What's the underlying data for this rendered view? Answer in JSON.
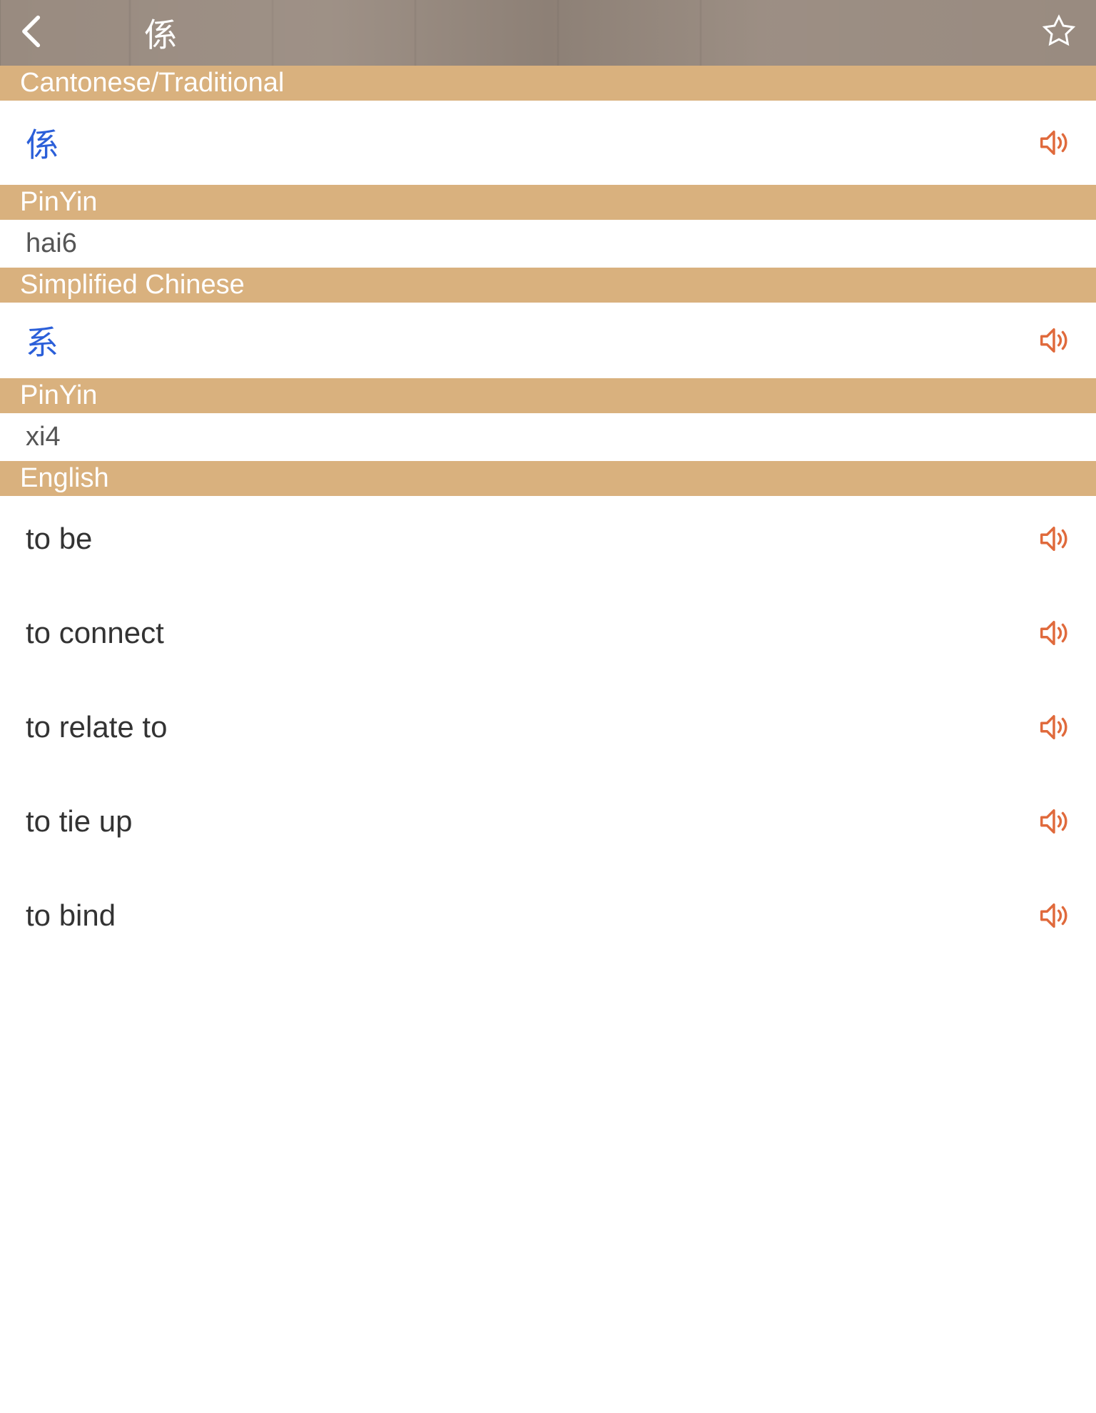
{
  "header": {
    "title": "係"
  },
  "sections": {
    "cantonese": {
      "header": "Cantonese/Traditional",
      "character": "係",
      "pinyin_label": "PinYin",
      "pinyin": "hai6"
    },
    "simplified": {
      "header": "Simplified Chinese",
      "character": "系",
      "pinyin_label": "PinYin",
      "pinyin": "xi4"
    },
    "english": {
      "header": "English",
      "items": [
        "to be",
        "to connect",
        "to relate to",
        "to tie up",
        "to bind"
      ]
    }
  }
}
